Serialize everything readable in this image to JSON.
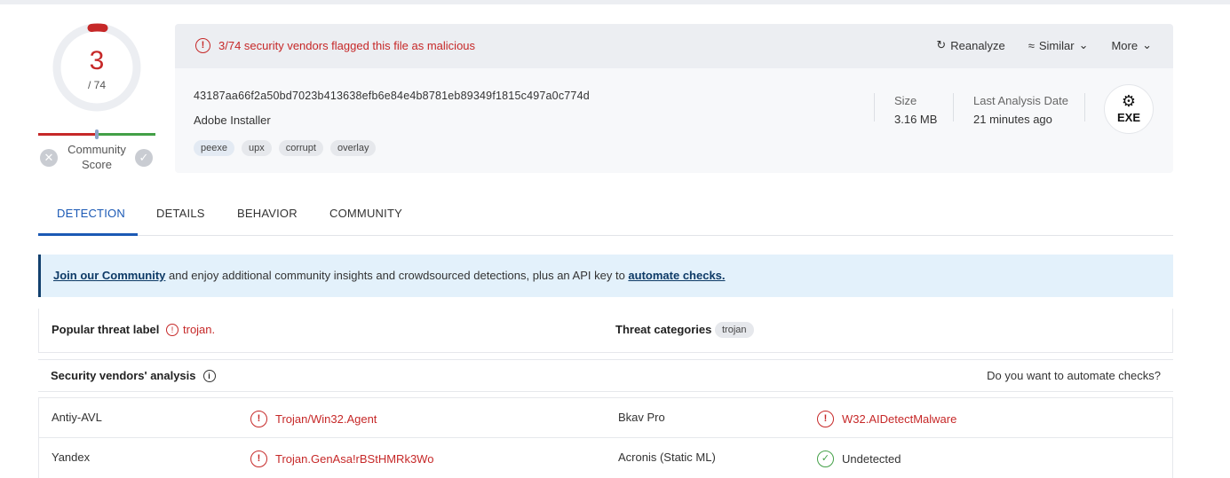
{
  "score": {
    "detections": "3",
    "total": "/ 74",
    "community_label": "Community Score"
  },
  "header": {
    "flag_text": "3/74 security vendors flagged this file as malicious",
    "actions": [
      "Reanalyze",
      "Similar",
      "More"
    ],
    "hash": "43187aa66f2a50bd7023b413638efb6e84e4b8781eb89349f1815c497a0c774d",
    "file_name": "Adobe Installer",
    "tags": [
      "peexe",
      "upx",
      "corrupt",
      "overlay"
    ],
    "size_label": "Size",
    "size_value": "3.16 MB",
    "date_label": "Last Analysis Date",
    "date_value": "21 minutes ago",
    "file_type": "EXE"
  },
  "tabs": [
    "DETECTION",
    "DETAILS",
    "BEHAVIOR",
    "COMMUNITY"
  ],
  "banner": {
    "link1": "Join our Community",
    "middle": " and enjoy additional community insights and crowdsourced detections, plus an API key to ",
    "link2": "automate checks."
  },
  "threat": {
    "label": "Popular threat label",
    "value": "trojan.",
    "categories_label": "Threat categories",
    "category": "trojan"
  },
  "vendors": {
    "title": "Security vendors' analysis",
    "automate": "Do you want to automate checks?",
    "rows": [
      {
        "v1": "Antiy-AVL",
        "r1": "Trojan/Win32.Agent",
        "v2": "Bkav Pro",
        "r2": "W32.AIDetectMalware"
      },
      {
        "v1": "Yandex",
        "r1": "Trojan.GenAsa!rBStHMRk3Wo",
        "v2": "Acronis (Static ML)",
        "r2": "Undetected"
      }
    ]
  },
  "colors": {
    "malicious": "#c62828",
    "clean": "#43a047",
    "accent": "#1b59b5"
  }
}
